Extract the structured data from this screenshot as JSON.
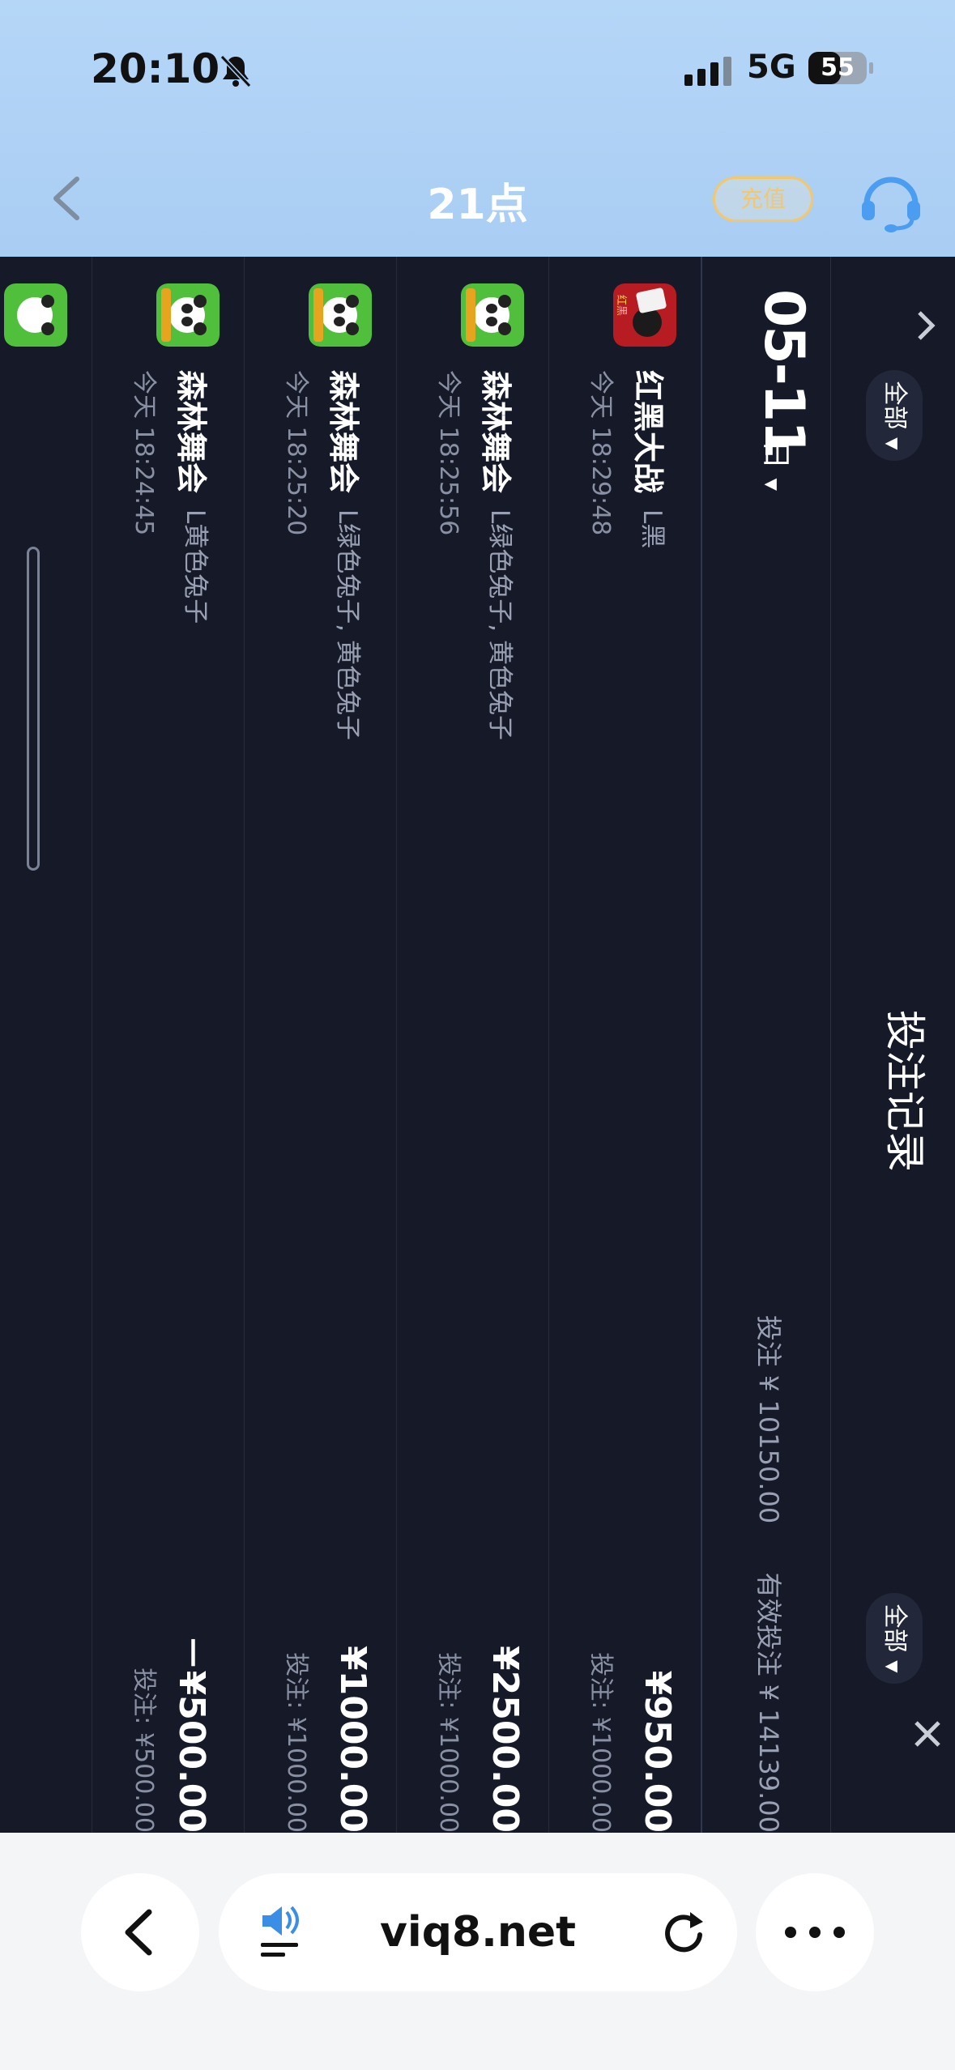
{
  "status_bar": {
    "time": "20:10",
    "network": "5G",
    "battery": "55",
    "battery_level": 0.55
  },
  "header": {
    "title": "21点",
    "recharge_label": "充值"
  },
  "records": {
    "title": "投注记录",
    "filter_left": "全部",
    "filter_right": "全部",
    "date": "05-11",
    "day": "日",
    "stats_bet": "投注 ¥ 10150.00",
    "stats_valid": "有效投注 ¥ 14139.00",
    "rows": [
      {
        "game": "红黑大战",
        "pick": "L黑",
        "time": "今天 18:29:48",
        "amount": "¥950.00",
        "bet": "投注: ¥1000.00"
      },
      {
        "game": "森林舞会",
        "pick": "L绿色兔子, 黄色兔子",
        "time": "今天 18:25:56",
        "amount": "¥2500.00",
        "bet": "投注: ¥1000.00"
      },
      {
        "game": "森林舞会",
        "pick": "L绿色兔子, 黄色兔子",
        "time": "今天 18:25:20",
        "amount": "¥1000.00",
        "bet": "投注: ¥1000.00"
      },
      {
        "game": "森林舞会",
        "pick": "L黄色兔子",
        "time": "今天 18:24:45",
        "amount": "－¥500.00",
        "bet": "投注: ¥500.00"
      }
    ]
  },
  "browser": {
    "url": "viq8.net"
  },
  "colors": {
    "panel_bg": "#161a28",
    "header_bg": "#aacdf3",
    "accent_gold": "#f3c76a",
    "service_blue": "#4a9df0"
  },
  "icons": {
    "back": "chevron-left-icon",
    "service": "headset-icon",
    "bell": "bell-slash-icon",
    "collapse": "chevron-up-icon",
    "close": "close-icon",
    "speaker": "speaker-icon",
    "reload": "reload-icon",
    "more": "more-icon"
  }
}
